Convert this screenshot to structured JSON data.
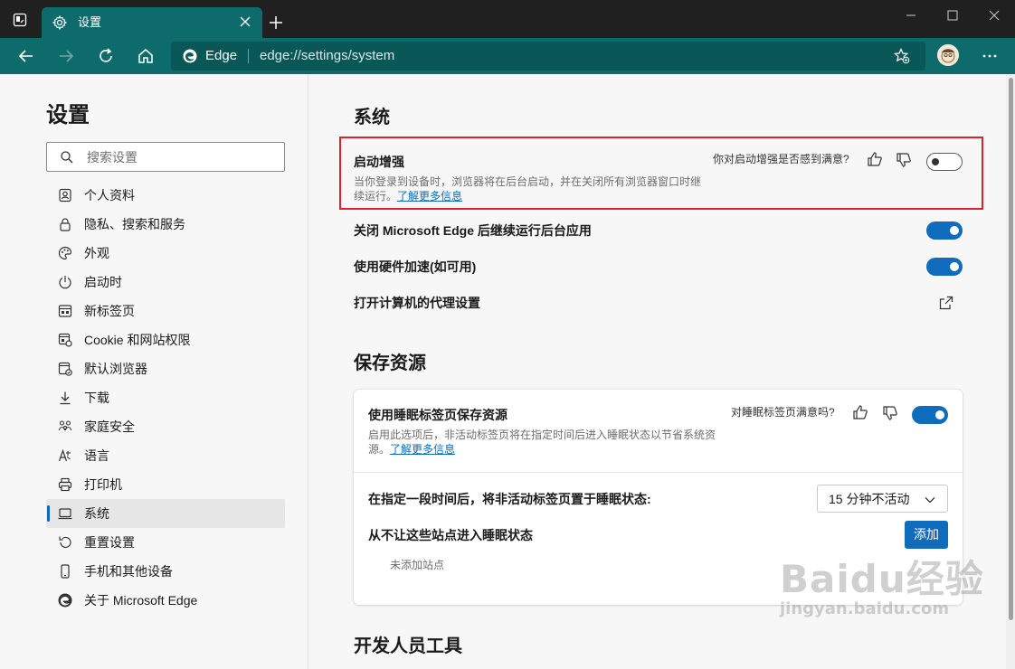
{
  "browser": {
    "tab_title": "设置",
    "address_brand": "Edge",
    "address_url": "edge://settings/system"
  },
  "sidebar": {
    "title": "设置",
    "search_placeholder": "搜索设置",
    "items": [
      {
        "label": "个人资料",
        "icon": "profile-icon"
      },
      {
        "label": "隐私、搜索和服务",
        "icon": "lock-icon"
      },
      {
        "label": "外观",
        "icon": "palette-icon"
      },
      {
        "label": "启动时",
        "icon": "power-icon"
      },
      {
        "label": "新标签页",
        "icon": "new-tab-icon"
      },
      {
        "label": "Cookie 和网站权限",
        "icon": "site-permissions-icon"
      },
      {
        "label": "默认浏览器",
        "icon": "default-browser-icon"
      },
      {
        "label": "下载",
        "icon": "download-icon"
      },
      {
        "label": "家庭安全",
        "icon": "family-icon"
      },
      {
        "label": "语言",
        "icon": "language-icon"
      },
      {
        "label": "打印机",
        "icon": "printer-icon"
      },
      {
        "label": "系统",
        "icon": "system-icon",
        "active": true
      },
      {
        "label": "重置设置",
        "icon": "reset-icon"
      },
      {
        "label": "手机和其他设备",
        "icon": "phone-icon"
      },
      {
        "label": "关于 Microsoft Edge",
        "icon": "edge-logo-icon"
      }
    ]
  },
  "system": {
    "heading": "系统",
    "startup_boost": {
      "title": "启动增强",
      "feedback_question": "你对启动增强是否感到满意?",
      "desc_line1": "当你登录到设备时，浏览器将在后台启动，并在关闭所有浏览器窗口时继",
      "desc_line2": "续运行。",
      "learn_more": "了解更多信息",
      "enabled": false
    },
    "background_apps": {
      "title": "关闭 Microsoft Edge 后继续运行后台应用",
      "enabled": true
    },
    "hardware_accel": {
      "title": "使用硬件加速(如可用)",
      "enabled": true
    },
    "proxy": {
      "title": "打开计算机的代理设置"
    }
  },
  "save_resources": {
    "heading": "保存资源",
    "sleeping_tabs": {
      "title": "使用睡眠标签页保存资源",
      "feedback_question": "对睡眠标签页满意吗?",
      "desc_line1": "启用此选项后，非活动标签页将在指定时间后进入睡眠状态以节省系统资",
      "desc_line2": "源。",
      "learn_more": "了解更多信息",
      "enabled": true
    },
    "sleep_after": {
      "label": "在指定一段时间后，将非活动标签页置于睡眠状态:",
      "selected": "15 分钟不活动"
    },
    "never_sleep": {
      "label": "从不让这些站点进入睡眠状态",
      "add_button": "添加",
      "empty_text": "未添加站点"
    }
  },
  "developer_tools": {
    "heading": "开发人员工具"
  },
  "watermark": {
    "line1": "Baidu经验",
    "line2": "jingyan.baidu.com"
  },
  "colors": {
    "accent": "#0f6cbd",
    "toolbar": "#0e6b6c",
    "highlight": "#e0202a"
  }
}
